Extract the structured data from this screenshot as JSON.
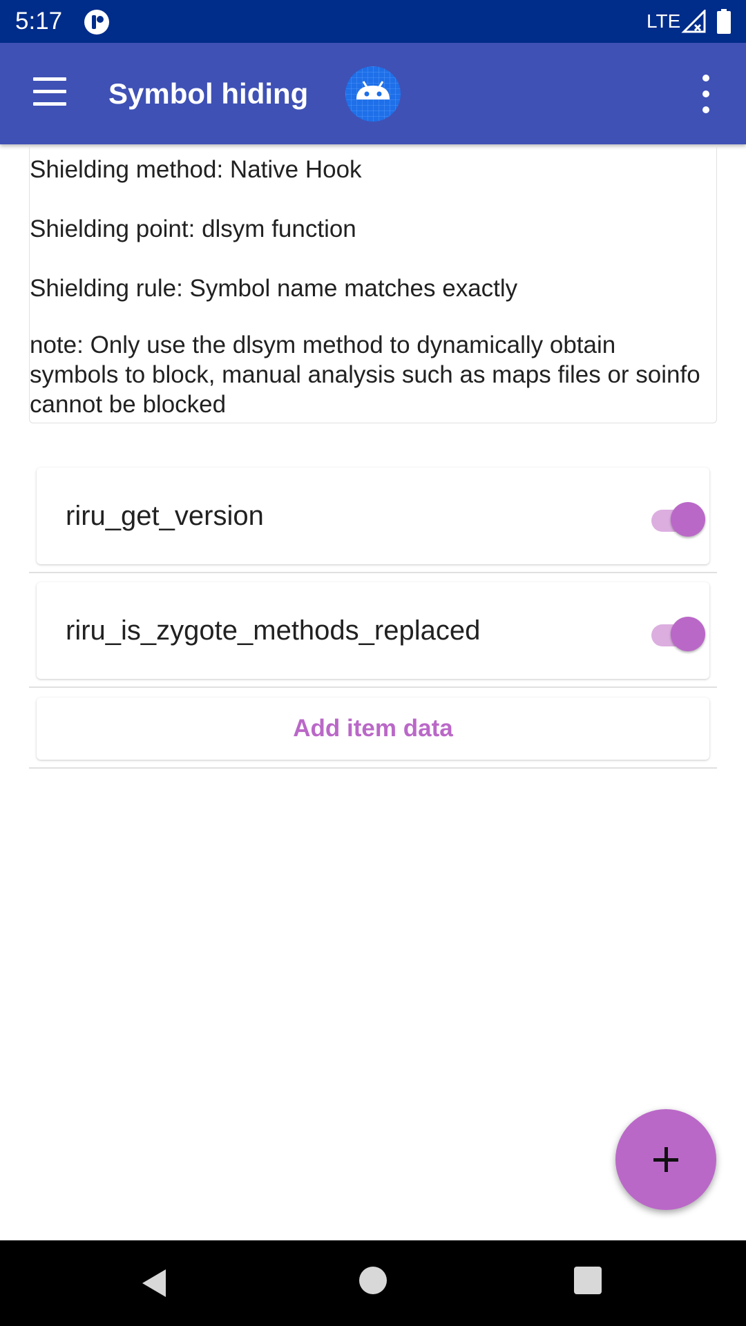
{
  "status_bar": {
    "time": "5:17",
    "network": "LTE",
    "icons": [
      "app-notification-icon",
      "signal-icon",
      "battery-icon"
    ]
  },
  "app_bar": {
    "title": "Symbol hiding",
    "icons": [
      "menu-icon",
      "android-logo-icon",
      "overflow-menu-icon"
    ]
  },
  "info": {
    "method": "Shielding method: Native Hook",
    "point": "Shielding point: dlsym function",
    "rule": "Shielding rule: Symbol name matches exactly",
    "note": "note: Only use the dlsym method to dynamically obtain symbols to block, manual analysis such as maps files or soinfo cannot be blocked"
  },
  "items": [
    {
      "label": "riru_get_version",
      "enabled": true
    },
    {
      "label": "riru_is_zygote_methods_replaced",
      "enabled": true
    }
  ],
  "add_item_label": "Add item data",
  "colors": {
    "status_bar": "#002c8a",
    "app_bar": "#3f51b5",
    "accent": "#ba68c8",
    "toggle_track": "#dcaee0"
  },
  "fab_icon": "plus-icon",
  "nav_bar": {
    "icons": [
      "back-icon",
      "home-icon",
      "recents-icon"
    ]
  }
}
